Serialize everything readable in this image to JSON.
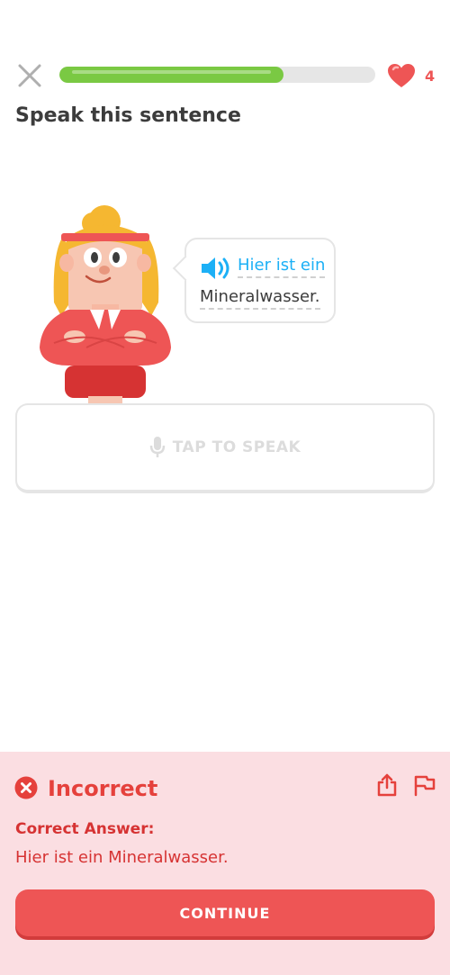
{
  "header": {
    "close_icon": "close-icon",
    "progress_fraction": 0.71,
    "hearts_count": "4",
    "heart_color": "#ee5555",
    "progress_color": "#7ac943"
  },
  "prompt": {
    "title": "Speak this sentence",
    "bubble": {
      "line1": "Hier ist ein",
      "line2": "Mineralwasser.",
      "speaker_icon": "speaker-icon"
    }
  },
  "tap_to_speak": {
    "label": "TAP TO SPEAK",
    "icon": "microphone-icon"
  },
  "feedback": {
    "status": "Incorrect",
    "correct_answer_label": "Correct Answer:",
    "correct_answer": "Hier ist ein Mineralwasser.",
    "continue_label": "CONTINUE",
    "panel_color": "#fbdee2",
    "accent_color": "#ee5555"
  }
}
